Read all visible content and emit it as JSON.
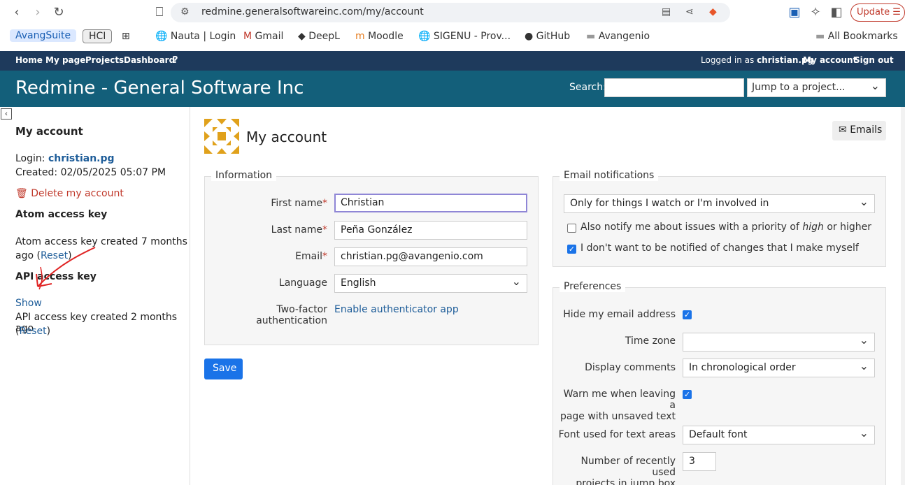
{
  "browser": {
    "url": "redmine.generalsoftwareinc.com/my/account",
    "update_label": "Update",
    "bookmarks": {
      "avang": "AvangSuite",
      "hci": "HCI",
      "nauta": "Nauta | Login",
      "gmail": "Gmail",
      "deepl": "DeepL",
      "moodle": "Moodle",
      "sigenu": "SIGENU - Prov...",
      "github": "GitHub",
      "avangenio": "Avangenio",
      "all": "All Bookmarks"
    }
  },
  "top_menu": {
    "home": "Home",
    "mypage": "My page",
    "projects": "Projects",
    "dashboard": "Dashboard",
    "help": "?",
    "logged_prefix": "Logged in as",
    "user": "christian.pg",
    "myaccount": "My account",
    "signout": "Sign out"
  },
  "header": {
    "title": "Redmine - General Software Inc",
    "search_label": "Search:",
    "jump_placeholder": "Jump to a project..."
  },
  "sidebar": {
    "title": "My account",
    "login_label": "Login:",
    "login_value": "christian.pg",
    "created": "Created: 02/05/2025 05:07 PM",
    "delete": "Delete my account",
    "atom_title": "Atom access key",
    "atom_text1": "Atom access key created 7 months",
    "atom_text2": "ago (",
    "reset": "Reset",
    "close_paren": ")",
    "api_title": "API access key",
    "show": "Show",
    "api_text": "API access key created 2 months ago",
    "open_paren": "("
  },
  "main": {
    "title": "My account",
    "emails_btn": "Emails",
    "info_legend": "Information",
    "first_name_label": "First name",
    "first_name": "Christian",
    "last_name_label": "Last name",
    "last_name": "Peña González",
    "email_label": "Email",
    "email": "christian.pg@avangenio.com",
    "language_label": "Language",
    "language": "English",
    "twofa_label1": "Two-factor",
    "twofa_label2": "authentication",
    "twofa_link": "Enable authenticator app",
    "save": "Save",
    "notif_legend": "Email notifications",
    "notif_select": "Only for things I watch or I'm involved in",
    "notif_priority_a": "Also notify me about issues with a priority of ",
    "notif_priority_em": "high",
    "notif_priority_b": " or higher",
    "notif_self": "I don't want to be notified of changes that I make myself",
    "pref_legend": "Preferences",
    "hide_email": "Hide my email address",
    "timezone": "Time zone",
    "display_comments": "Display comments",
    "display_comments_value": "In chronological order",
    "warn1": "Warn me when leaving a",
    "warn2": "page with unsaved text",
    "font_label": "Font used for text areas",
    "font_value": "Default font",
    "recent1": "Number of recently used",
    "recent2": "projects in jump box",
    "recent_value": "3"
  },
  "colors": {
    "top_menu": "#1e3a5c",
    "header": "#135f7a",
    "link": "#1e5d99",
    "primary_button": "#1a73e8",
    "danger": "#c0392b"
  }
}
